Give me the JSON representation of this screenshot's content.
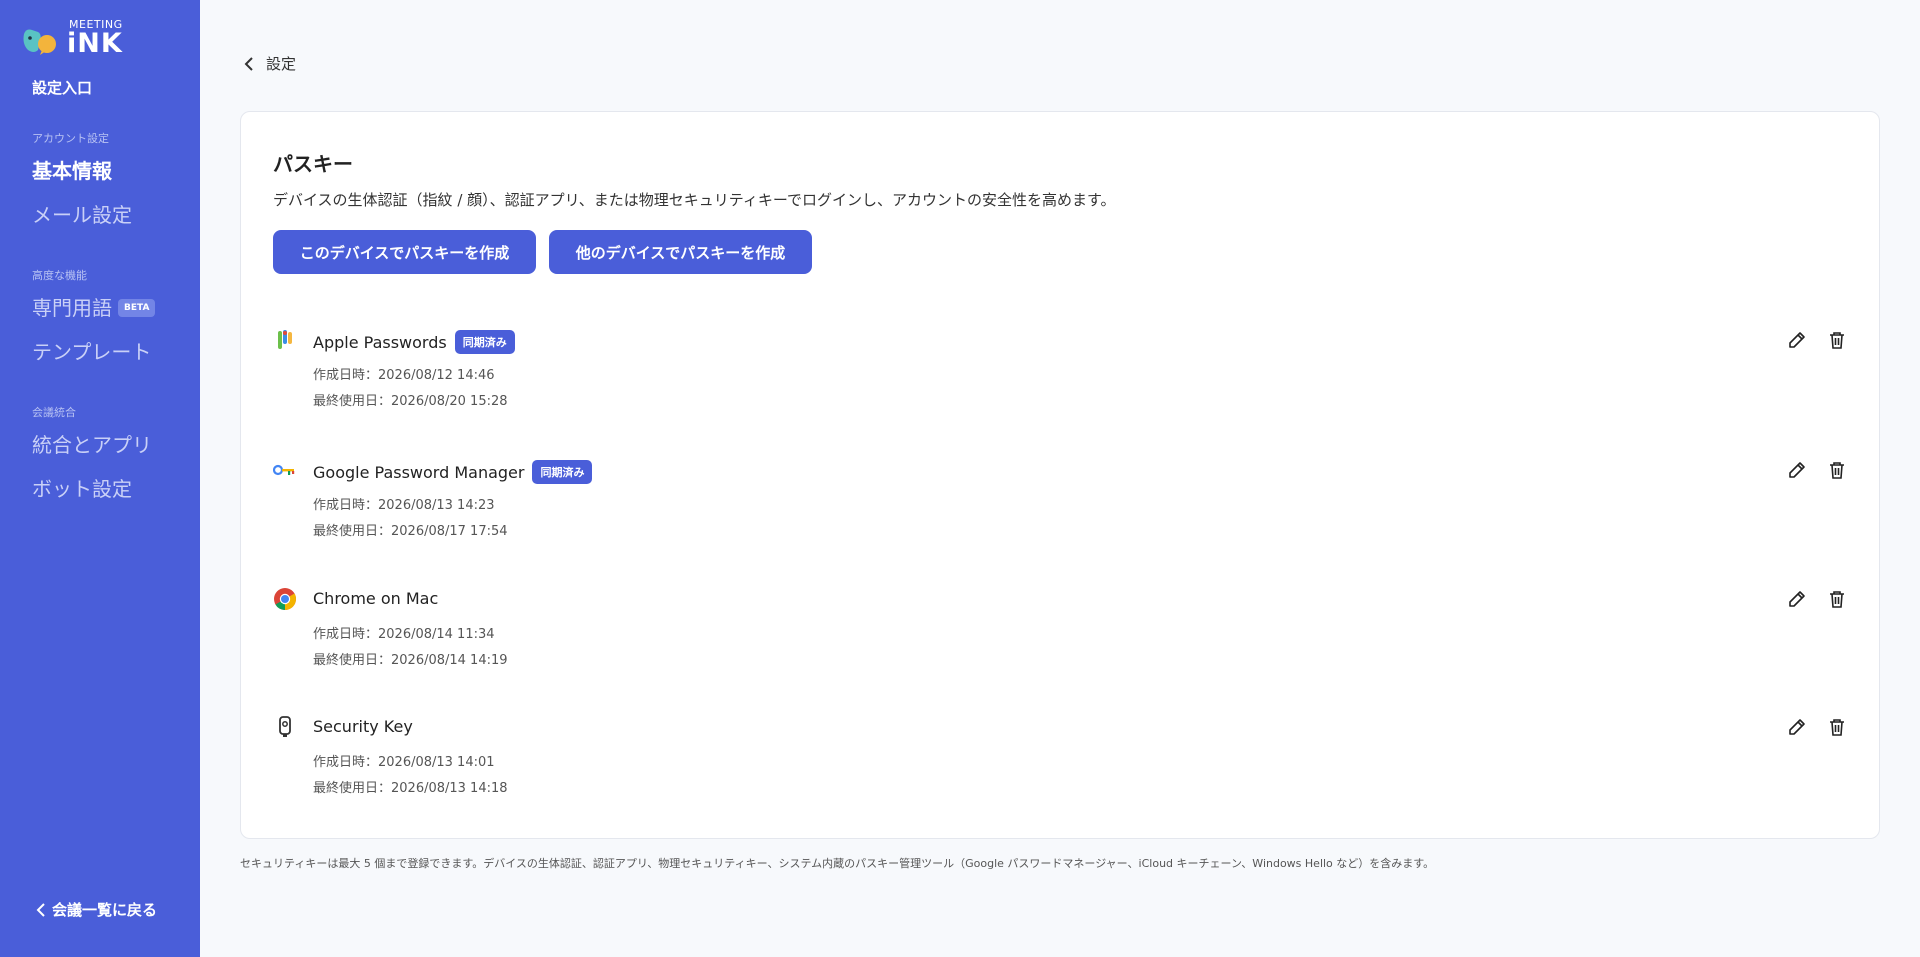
{
  "sidebar": {
    "logo_small": "MEETING",
    "logo_big": "iNK",
    "entry_title": "設定入口",
    "sections": [
      {
        "label": "アカウント設定",
        "items": [
          {
            "label": "基本情報",
            "active": true
          },
          {
            "label": "メール設定",
            "active": false
          }
        ]
      },
      {
        "label": "高度な機能",
        "items": [
          {
            "label": "専門用語",
            "badge": "BETA",
            "active": false
          },
          {
            "label": "テンプレート",
            "active": false
          }
        ]
      },
      {
        "label": "会議統合",
        "items": [
          {
            "label": "統合とアプリ",
            "active": false
          },
          {
            "label": "ボット設定",
            "active": false
          }
        ]
      }
    ],
    "back_label": "会議一覧に戻る"
  },
  "breadcrumb": {
    "label": "設定"
  },
  "card": {
    "title": "パスキー",
    "description": "デバイスの生体認証（指紋 / 顔）、認証アプリ、または物理セキュリティキーでログインし、アカウントの安全性を高めます。",
    "create_this_device": "このデバイスでパスキーを作成",
    "create_other_device": "他のデバイスでパスキーを作成"
  },
  "passkeys": [
    {
      "name": "Apple Passwords",
      "icon": "apple-passwords-icon",
      "synced": "同期済み",
      "created": "作成日時：2026/08/12 14:46",
      "last_used": "最終使用日：2026/08/20 15:28"
    },
    {
      "name": "Google Password Manager",
      "icon": "google-password-manager-icon",
      "synced": "同期済み",
      "created": "作成日時：2026/08/13 14:23",
      "last_used": "最終使用日：2026/08/17 17:54"
    },
    {
      "name": "Chrome on Mac",
      "icon": "chrome-icon",
      "synced": "",
      "created": "作成日時：2026/08/14 11:34",
      "last_used": "最終使用日：2026/08/14 14:19"
    },
    {
      "name": "Security Key",
      "icon": "security-key-icon",
      "synced": "",
      "created": "作成日時：2026/08/13 14:01",
      "last_used": "最終使用日：2026/08/13 14:18"
    }
  ],
  "footnote": "セキュリティキーは最大 5 個まで登録できます。デバイスの生体認証、認証アプリ、物理セキュリティキー、システム内蔵のパスキー管理ツール（Google パスワードマネージャー、iCloud キーチェーン、Windows Hello など）を含みます。",
  "colors": {
    "accent": "#4a5ed9",
    "sidebar_bg": "#4a5ed9",
    "page_bg": "#f7f9fc"
  }
}
